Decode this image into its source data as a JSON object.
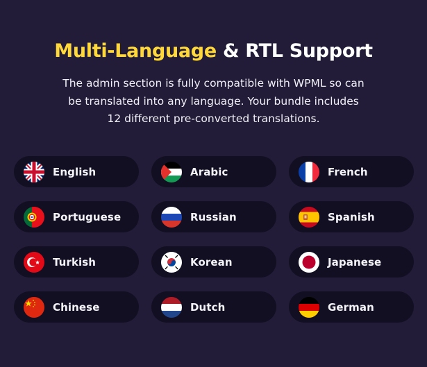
{
  "header": {
    "title_highlight": "Multi-Language",
    "title_rest": " & RTL Support",
    "description_lines": [
      "The admin section is fully compatible with WPML so can",
      "be translated into any language. Your bundle includes",
      "12 different pre-converted translations."
    ]
  },
  "colors": {
    "background": "#221c38",
    "pill": "#130f22",
    "accent": "#ffd93b"
  },
  "languages": [
    {
      "label": "English",
      "flag": "uk-flag-icon"
    },
    {
      "label": "Arabic",
      "flag": "palestine-flag-icon"
    },
    {
      "label": "French",
      "flag": "france-flag-icon"
    },
    {
      "label": "Portuguese",
      "flag": "portugal-flag-icon"
    },
    {
      "label": "Russian",
      "flag": "russia-flag-icon"
    },
    {
      "label": "Spanish",
      "flag": "spain-flag-icon"
    },
    {
      "label": "Turkish",
      "flag": "turkey-flag-icon"
    },
    {
      "label": "Korean",
      "flag": "south-korea-flag-icon"
    },
    {
      "label": "Japanese",
      "flag": "japan-flag-icon"
    },
    {
      "label": "Chinese",
      "flag": "china-flag-icon"
    },
    {
      "label": "Dutch",
      "flag": "netherlands-flag-icon"
    },
    {
      "label": "German",
      "flag": "germany-flag-icon"
    }
  ]
}
